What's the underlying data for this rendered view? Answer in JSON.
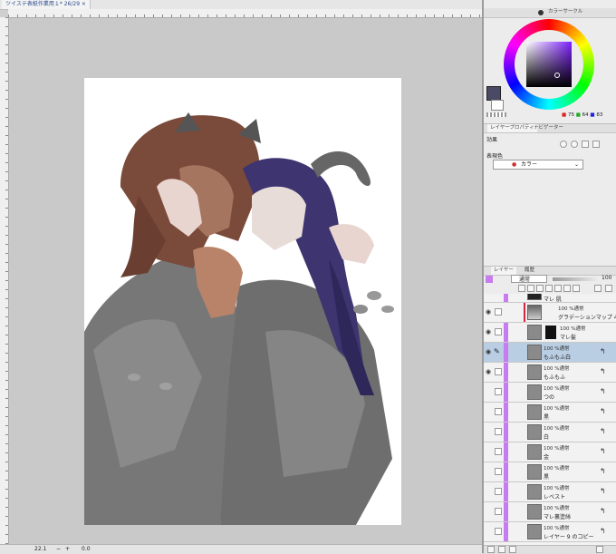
{
  "document_tab": {
    "title": "ツイステ表紙作業用１* 26/29 ×"
  },
  "statusbar": {
    "zoom": "22.1",
    "angle": "0.0"
  },
  "color_panel": {
    "tab_label": "カラーサークル",
    "values": {
      "h": "75",
      "s": "64",
      "v": "83"
    }
  },
  "layer_property": {
    "tabs": [
      "レイヤープロパティ",
      "ナビゲーター"
    ],
    "effect_label": "効果",
    "expression_label": "表現色",
    "expression_value": "カラー"
  },
  "layer_panel": {
    "tabs": [
      "レイヤー",
      "履歴"
    ],
    "blend_mode": "通常",
    "opacity": "100",
    "layers": [
      {
        "mode": "",
        "name": "マレ 肌"
      },
      {
        "mode": "100 %通常",
        "name": "グラデーションマップ 4"
      },
      {
        "mode": "100 %通常",
        "name": "マレ髪"
      },
      {
        "mode": "100 %通常",
        "name": "もふもふ白"
      },
      {
        "mode": "100 %通常",
        "name": "もふもふ"
      },
      {
        "mode": "100 %通常",
        "name": "つの"
      },
      {
        "mode": "100 %通常",
        "name": "黒"
      },
      {
        "mode": "100 %通常",
        "name": "白"
      },
      {
        "mode": "100 %通常",
        "name": "金"
      },
      {
        "mode": "100 %通常",
        "name": "黒"
      },
      {
        "mode": "100 %通常",
        "name": "レベスト"
      },
      {
        "mode": "100 %通常",
        "name": "マレ裏塗絲"
      },
      {
        "mode": "100 %通常",
        "name": "レイヤー 9 のコピー"
      }
    ]
  },
  "colors": {
    "accent": "#c77bf0",
    "selected": "#b9cde3",
    "swatch_main": "#4a4a66"
  }
}
